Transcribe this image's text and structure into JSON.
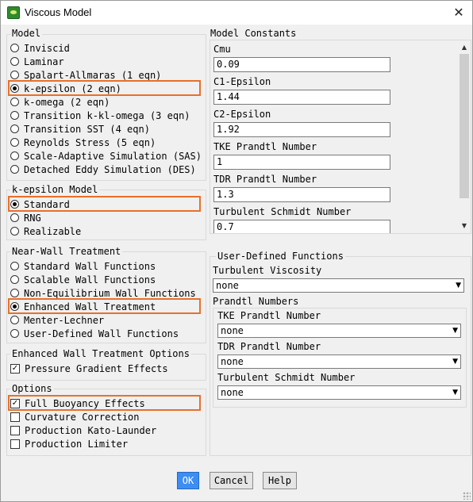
{
  "window": {
    "title": "Viscous Model",
    "icon": "app-icon",
    "close_icon": "close-icon"
  },
  "model": {
    "title": "Model",
    "options": [
      {
        "label": "Inviscid",
        "selected": false
      },
      {
        "label": "Laminar",
        "selected": false
      },
      {
        "label": "Spalart-Allmaras (1 eqn)",
        "selected": false
      },
      {
        "label": "k-epsilon (2 eqn)",
        "selected": true
      },
      {
        "label": "k-omega (2 eqn)",
        "selected": false
      },
      {
        "label": "Transition k-kl-omega (3 eqn)",
        "selected": false
      },
      {
        "label": "Transition SST (4 eqn)",
        "selected": false
      },
      {
        "label": "Reynolds Stress (5 eqn)",
        "selected": false
      },
      {
        "label": "Scale-Adaptive Simulation (SAS)",
        "selected": false
      },
      {
        "label": "Detached Eddy Simulation (DES)",
        "selected": false
      }
    ]
  },
  "ke_model": {
    "title": "k-epsilon Model",
    "options": [
      {
        "label": "Standard",
        "selected": true
      },
      {
        "label": "RNG",
        "selected": false
      },
      {
        "label": "Realizable",
        "selected": false
      }
    ]
  },
  "near_wall": {
    "title": "Near-Wall Treatment",
    "options": [
      {
        "label": "Standard Wall Functions",
        "selected": false
      },
      {
        "label": "Scalable Wall Functions",
        "selected": false
      },
      {
        "label": "Non-Equilibrium Wall Functions",
        "selected": false
      },
      {
        "label": "Enhanced Wall Treatment",
        "selected": true
      },
      {
        "label": "Menter-Lechner",
        "selected": false
      },
      {
        "label": "User-Defined Wall Functions",
        "selected": false
      }
    ]
  },
  "ewt_options": {
    "title": "Enhanced Wall Treatment Options",
    "options": [
      {
        "label": "Pressure Gradient Effects",
        "checked": true
      }
    ]
  },
  "options": {
    "title": "Options",
    "options": [
      {
        "label": "Full Buoyancy Effects",
        "checked": true
      },
      {
        "label": "Curvature Correction",
        "checked": false
      },
      {
        "label": "Production Kato-Launder",
        "checked": false
      },
      {
        "label": "Production Limiter",
        "checked": false
      }
    ]
  },
  "model_constants": {
    "title": "Model Constants",
    "items": [
      {
        "label": "Cmu",
        "value": "0.09"
      },
      {
        "label": "C1-Epsilon",
        "value": "1.44"
      },
      {
        "label": "C2-Epsilon",
        "value": "1.92"
      },
      {
        "label": "TKE Prandtl Number",
        "value": "1"
      },
      {
        "label": "TDR Prandtl Number",
        "value": "1.3"
      },
      {
        "label": "Turbulent Schmidt Number",
        "value": "0.7"
      }
    ]
  },
  "udf": {
    "title": "User-Defined Functions",
    "turbulent_viscosity_label": "Turbulent Viscosity",
    "turbulent_viscosity_value": "none",
    "prandtl_title": "Prandtl Numbers",
    "prandtl": [
      {
        "label": "TKE Prandtl Number",
        "value": "none"
      },
      {
        "label": "TDR Prandtl Number",
        "value": "none"
      },
      {
        "label": "Turbulent Schmidt Number",
        "value": "none"
      }
    ]
  },
  "buttons": {
    "ok": "OK",
    "cancel": "Cancel",
    "help": "Help"
  },
  "colors": {
    "highlight": "#e8702a",
    "primary_button": "#3c8ef3",
    "dialog_bg": "#f0f0f0"
  }
}
